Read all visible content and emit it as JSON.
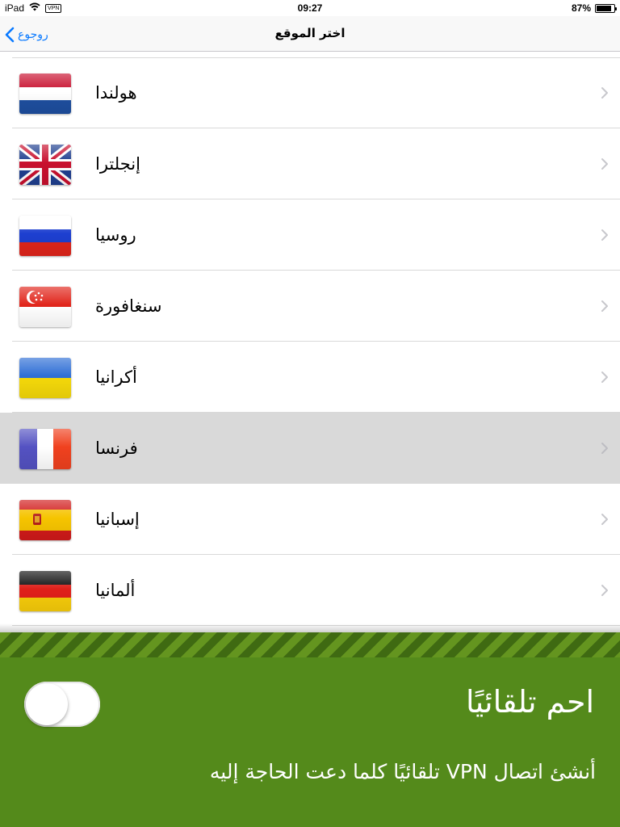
{
  "status_bar": {
    "device": "iPad",
    "vpn_badge": "VPN",
    "time": "09:27",
    "battery_text": "87%",
    "battery_level": 0.87
  },
  "nav": {
    "title": "اختر الموقع",
    "back_label": "روجوع"
  },
  "countries": [
    {
      "name": "هولندا",
      "flag": "netherlands-flag-icon",
      "selected": false
    },
    {
      "name": "إنجلترا",
      "flag": "uk-flag-icon",
      "selected": false
    },
    {
      "name": "روسيا",
      "flag": "russia-flag-icon",
      "selected": false
    },
    {
      "name": "سنغافورة",
      "flag": "singapore-flag-icon",
      "selected": false
    },
    {
      "name": "أكرانيا",
      "flag": "ukraine-flag-icon",
      "selected": false
    },
    {
      "name": "فرنسا",
      "flag": "france-flag-icon",
      "selected": true
    },
    {
      "name": "إسبانيا",
      "flag": "spain-flag-icon",
      "selected": false
    },
    {
      "name": "ألمانيا",
      "flag": "germany-flag-icon",
      "selected": false
    }
  ],
  "panel": {
    "title": "احم تلقائيًا",
    "description": "أنشئ اتصال VPN تلقائيًا كلما دعت الحاجة إليه",
    "toggle_on": false
  },
  "colors": {
    "accent": "#0a7aff",
    "panel_green": "#548a1b",
    "selected_row": "#d9d9d9"
  }
}
